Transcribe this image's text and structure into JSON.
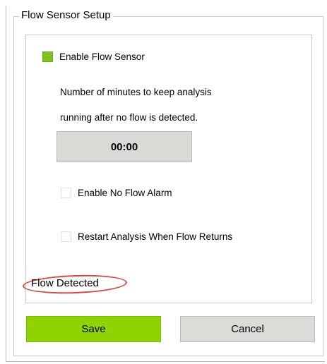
{
  "window": {
    "group_title": "Flow Sensor Setup"
  },
  "flow_sensor": {
    "enable_label": "Enable Flow Sensor",
    "enable_checked": true,
    "description_line1": "Number of minutes to keep analysis",
    "description_line2": "running after no flow is detected.",
    "time_value": "00:00",
    "no_flow_alarm_label": "Enable No Flow Alarm",
    "no_flow_alarm_checked": false,
    "restart_label": "Restart Analysis When Flow Returns",
    "restart_checked": false,
    "status_text": "Flow Detected"
  },
  "footer": {
    "save_label": "Save",
    "cancel_label": "Cancel"
  },
  "colors": {
    "checkbox_checked": "#7dc21e",
    "save_button": "#8fd400",
    "cancel_button": "#dbdbd8",
    "time_button": "#d9d9d5",
    "annotation_ellipse": "#d24b4b"
  }
}
